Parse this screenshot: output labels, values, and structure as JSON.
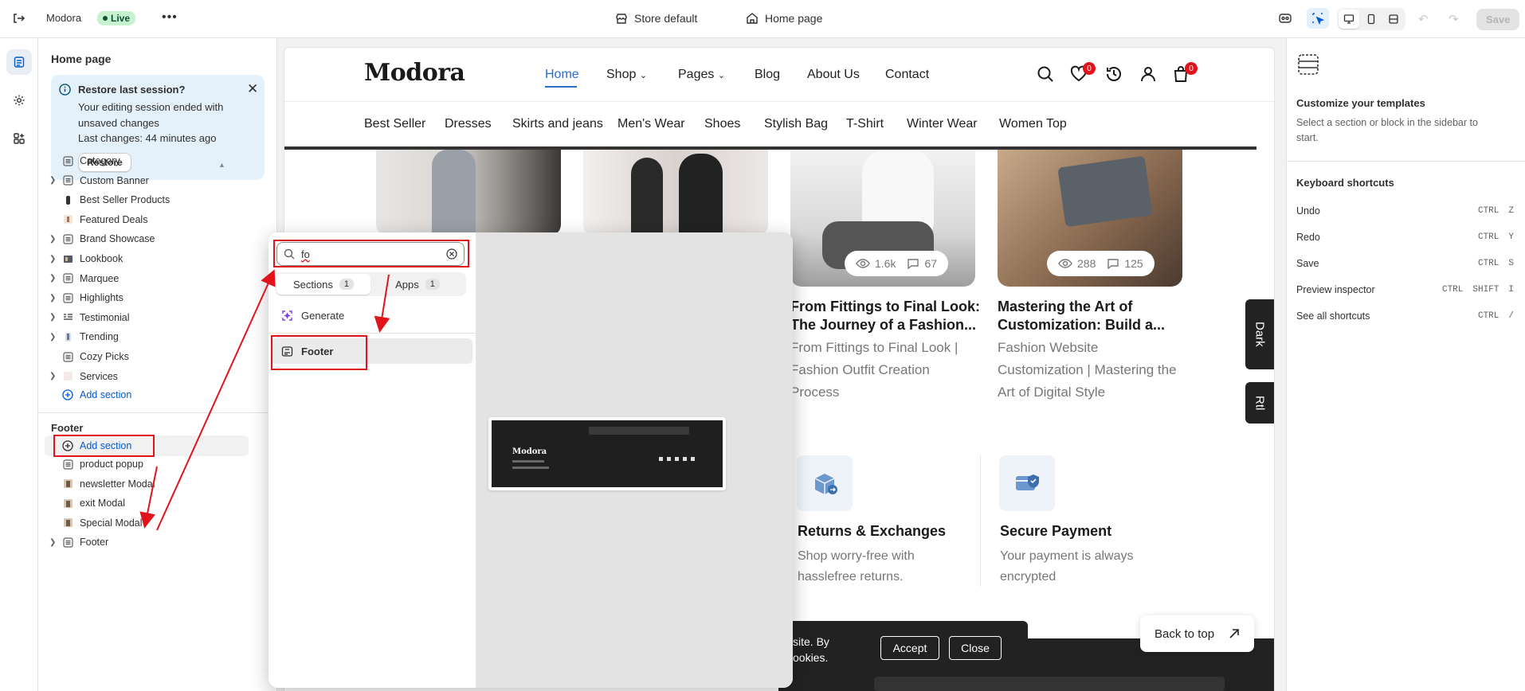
{
  "topbar": {
    "store_name": "Modora",
    "live_label": "Live",
    "store_selector": "Store default",
    "page_selector": "Home page",
    "save_label": "Save"
  },
  "sidebar": {
    "title": "Home page",
    "banner": {
      "title": "Restore last session?",
      "desc": "Your editing session ended with unsaved changes",
      "last": "Last changes: 44 minutes ago",
      "restore": "Restore"
    },
    "items": [
      {
        "label": "Category"
      },
      {
        "label": "Custom Banner"
      },
      {
        "label": "Best Seller Products"
      },
      {
        "label": "Featured Deals"
      },
      {
        "label": "Brand Showcase"
      },
      {
        "label": "Lookbook"
      },
      {
        "label": "Marquee"
      },
      {
        "label": "Highlights"
      },
      {
        "label": "Testimonial"
      },
      {
        "label": "Trending"
      },
      {
        "label": "Cozy Picks"
      },
      {
        "label": "Services"
      }
    ],
    "add_section": "Add section",
    "footer_heading": "Footer",
    "footer_items": [
      {
        "label": "product popup"
      },
      {
        "label": "newsletter Modal"
      },
      {
        "label": "exit Modal"
      },
      {
        "label": "Special Modal"
      },
      {
        "label": "Footer"
      }
    ]
  },
  "popover": {
    "search_value": "fo",
    "tabs": [
      {
        "label": "Sections",
        "count": "1"
      },
      {
        "label": "Apps",
        "count": "1"
      }
    ],
    "generate": "Generate",
    "result": "Footer",
    "preview_logo": "Modora"
  },
  "store": {
    "logo": "Modora",
    "menu": [
      "Home",
      "Shop",
      "Pages",
      "Blog",
      "About Us",
      "Contact"
    ],
    "wishlist_count": "0",
    "cart_count": "0",
    "categories": [
      "Best Seller",
      "Dresses",
      "Skirts and jeans",
      "Men's Wear",
      "Shoes",
      "Stylish Bag",
      "T-Shirt",
      "Winter Wear",
      "Women Top"
    ],
    "posts": [
      {
        "views": "1.6k",
        "comments": "67",
        "title": "From Fittings to Final Look: The Journey of a Fashion...",
        "desc": "From Fittings to Final Look | Fashion Outfit Creation Process"
      },
      {
        "views": "288",
        "comments": "125",
        "title": "Mastering the Art of Customization: Build a...",
        "desc": "Fashion Website Customization | Mastering the Art of Digital Style"
      }
    ],
    "features": [
      {
        "title": "Returns & Exchanges",
        "desc": "Shop worry-free with hasslefree returns."
      },
      {
        "title": "Secure Payment",
        "desc": "Your payment is always encrypted"
      }
    ],
    "dark_tab": "Dark",
    "rtl_tab": "Rtl",
    "cookie_text_1": "site. By",
    "cookie_text_2": "ookies.",
    "accept": "Accept",
    "close": "Close",
    "back_to_top": "Back to top"
  },
  "rpanel": {
    "title": "Customize your templates",
    "desc": "Select a section or block in the sidebar to start.",
    "shortcuts_title": "Keyboard shortcuts",
    "shortcuts": [
      {
        "label": "Undo",
        "keys": [
          "CTRL",
          "Z"
        ]
      },
      {
        "label": "Redo",
        "keys": [
          "CTRL",
          "Y"
        ]
      },
      {
        "label": "Save",
        "keys": [
          "CTRL",
          "S"
        ]
      },
      {
        "label": "Preview inspector",
        "keys": [
          "CTRL",
          "SHIFT",
          "I"
        ]
      },
      {
        "label": "See all shortcuts",
        "keys": [
          "CTRL",
          "/"
        ]
      }
    ]
  },
  "colors": {
    "accent": "#005bd3",
    "highlight": "#e1141b",
    "live_bg": "#c8f2cf"
  }
}
